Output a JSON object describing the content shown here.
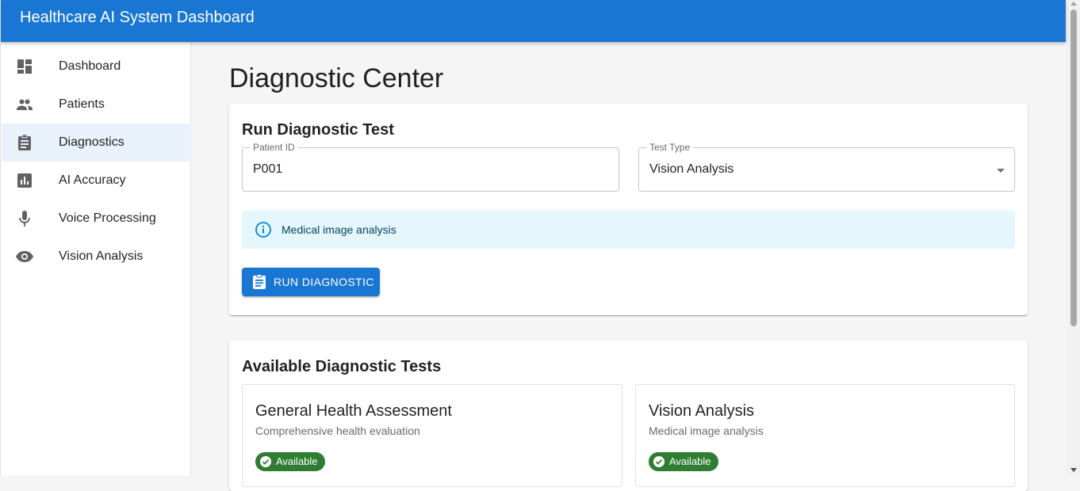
{
  "app": {
    "title": "Healthcare AI System Dashboard"
  },
  "sidebar": {
    "items": [
      {
        "label": "Dashboard",
        "icon": "dashboard-icon",
        "active": false
      },
      {
        "label": "Patients",
        "icon": "people-icon",
        "active": false
      },
      {
        "label": "Diagnostics",
        "icon": "clipboard-icon",
        "active": true
      },
      {
        "label": "AI Accuracy",
        "icon": "bar-chart-icon",
        "active": false
      },
      {
        "label": "Voice Processing",
        "icon": "microphone-icon",
        "active": false
      },
      {
        "label": "Vision Analysis",
        "icon": "eye-icon",
        "active": false
      }
    ]
  },
  "main": {
    "page_title": "Diagnostic Center",
    "run_card": {
      "title": "Run Diagnostic Test",
      "patient_field": {
        "label": "Patient ID",
        "value": "P001"
      },
      "test_type_field": {
        "label": "Test Type",
        "value": "Vision Analysis"
      },
      "info_alert": "Medical image analysis",
      "run_button": "RUN DIAGNOSTIC"
    },
    "tests_card": {
      "title": "Available Diagnostic Tests",
      "tests": [
        {
          "name": "General Health Assessment",
          "description": "Comprehensive health evaluation",
          "status": "Available"
        },
        {
          "name": "Vision Analysis",
          "description": "Medical image analysis",
          "status": "Available"
        }
      ]
    }
  },
  "colors": {
    "primary": "#1976d2",
    "success": "#2e7d32",
    "info_bg": "#e5f6fd",
    "active_nav_bg": "#e9f1fa"
  }
}
